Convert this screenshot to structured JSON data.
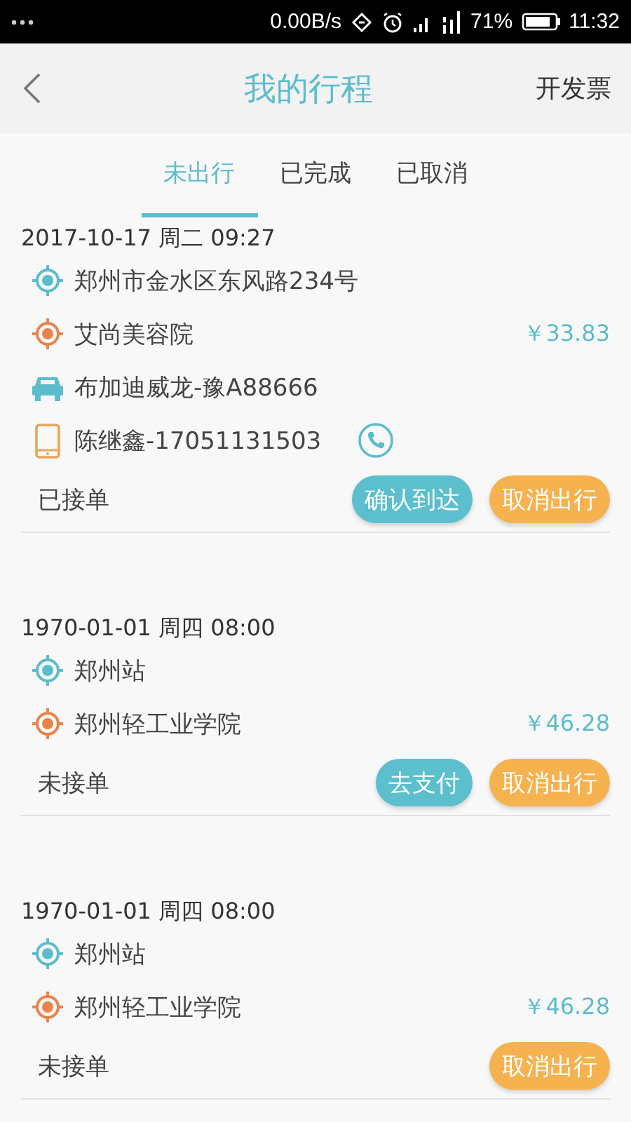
{
  "status_bar": {
    "network_speed": "0.00B/s",
    "battery": "71%",
    "time": "11:32"
  },
  "header": {
    "title": "我的行程",
    "action": "开发票"
  },
  "tabs": [
    {
      "label": "未出行",
      "selected": true
    },
    {
      "label": "已完成",
      "selected": false
    },
    {
      "label": "已取消",
      "selected": false
    }
  ],
  "trips": [
    {
      "date": "2017-10-17 周二 09:27",
      "rows": [
        {
          "kind": "origin",
          "text": "郑州市金水区东风路234号"
        },
        {
          "kind": "destination",
          "text": "艾尚美容院",
          "price": "￥33.83"
        },
        {
          "kind": "car",
          "text": "布加迪威龙-豫A88666"
        },
        {
          "kind": "driver",
          "text": "陈继鑫-17051131503",
          "call": true
        }
      ],
      "status": "已接单",
      "buttons": [
        {
          "kind": "primary",
          "label": "确认到达"
        },
        {
          "kind": "secondary",
          "label": "取消出行"
        }
      ]
    },
    {
      "date": "1970-01-01 周四 08:00",
      "rows": [
        {
          "kind": "origin",
          "text": "郑州站"
        },
        {
          "kind": "destination",
          "text": "郑州轻工业学院",
          "price": "￥46.28"
        }
      ],
      "status": "未接单",
      "buttons": [
        {
          "kind": "primary",
          "label": "去支付"
        },
        {
          "kind": "secondary",
          "label": "取消出行"
        }
      ]
    },
    {
      "date": "1970-01-01 周四 08:00",
      "rows": [
        {
          "kind": "origin",
          "text": "郑州站"
        },
        {
          "kind": "destination",
          "text": "郑州轻工业学院",
          "price": "￥46.28"
        }
      ],
      "status": "未接单",
      "buttons": [
        {
          "kind": "secondary",
          "label": "取消出行"
        }
      ]
    }
  ]
}
